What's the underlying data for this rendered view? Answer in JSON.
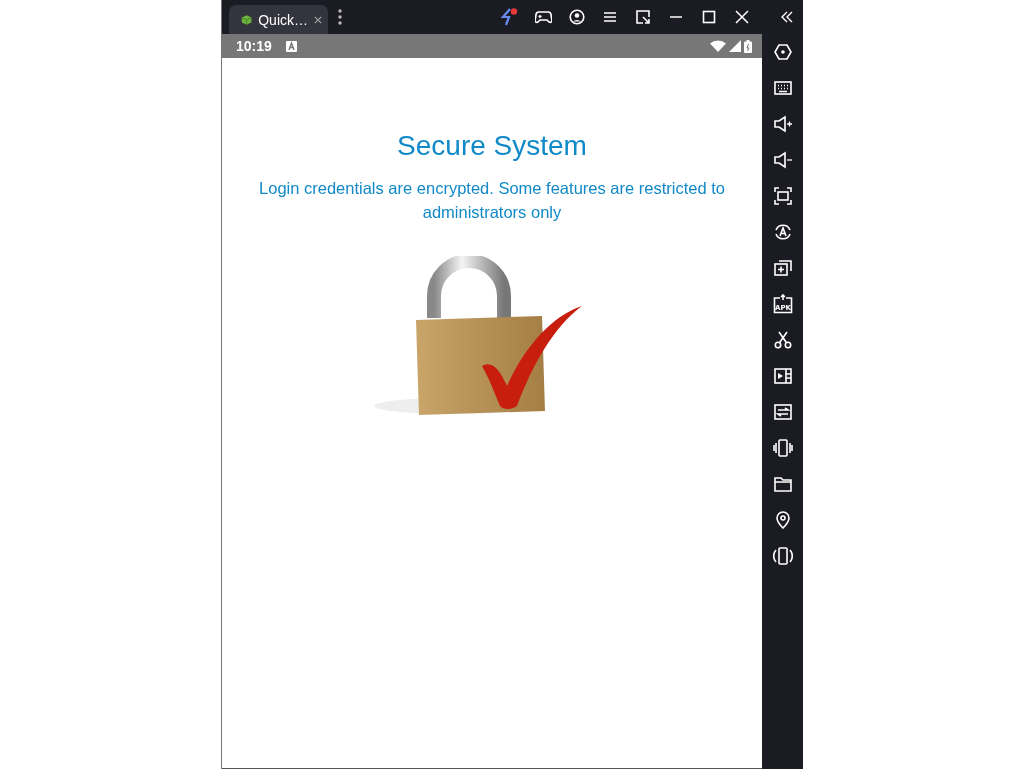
{
  "tab": {
    "title": "Quick…"
  },
  "status_bar": {
    "time": "10:19"
  },
  "app": {
    "title": "Secure System",
    "message": "Login credentials are encrypted. Some features are restricted to administrators only"
  },
  "sidebar": {
    "apk_label": "APK"
  }
}
